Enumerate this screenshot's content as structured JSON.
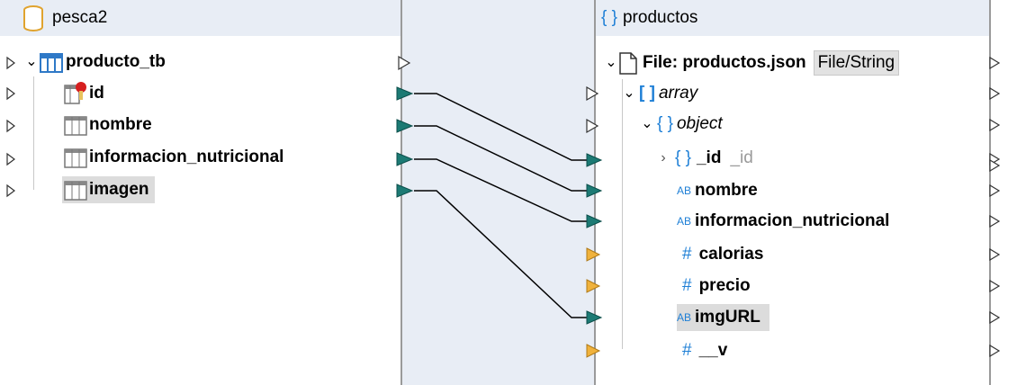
{
  "left": {
    "title": "pesca2",
    "table": "producto_tb",
    "fields": [
      "id",
      "nombre",
      "informacion_nutricional",
      "imagen"
    ]
  },
  "right": {
    "title": "productos",
    "file_label": "File: productos.json",
    "file_badge": "File/String",
    "array_label": "array",
    "object_label": "object",
    "id_label": "_id",
    "id_type": "_id",
    "fields": [
      "nombre",
      "informacion_nutricional",
      "calorias",
      "precio",
      "imgURL",
      "__v"
    ],
    "type_icons": [
      "AB",
      "AB",
      "#",
      "#",
      "AB",
      "#"
    ]
  },
  "colors": {
    "connected_port": "#1c7a74",
    "unmapped_port": "#f0b23c",
    "empty_port": "#ffffff",
    "mapped_table_icon": "#1e7fd6",
    "key_icon": "#d61f1f"
  }
}
